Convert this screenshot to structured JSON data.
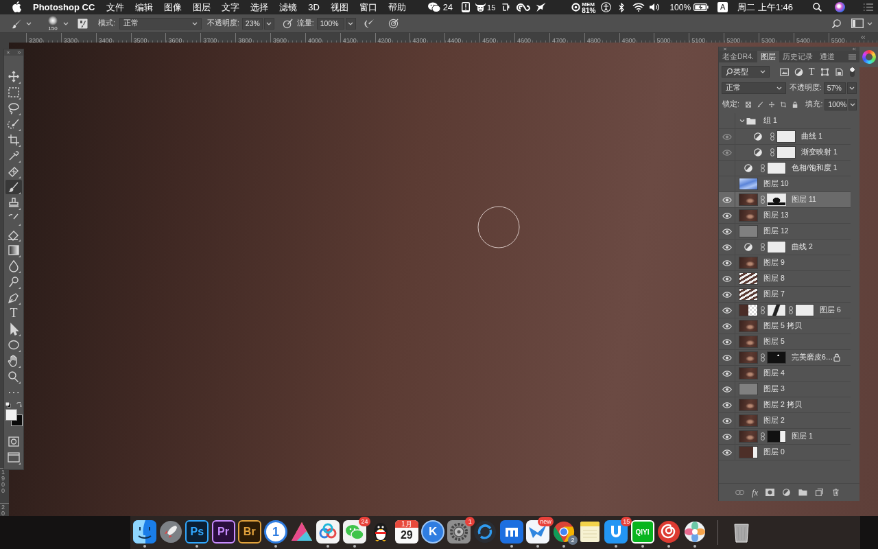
{
  "menubar": {
    "app": "Photoshop CC",
    "menus": [
      "文件",
      "编辑",
      "图像",
      "图层",
      "文字",
      "选择",
      "滤镜",
      "3D",
      "视图",
      "窗口",
      "帮助"
    ],
    "status": [
      {
        "kind": "wechat",
        "text": "24"
      },
      {
        "kind": "notebook"
      },
      {
        "kind": "bull",
        "text": "15"
      },
      {
        "kind": "hook"
      },
      {
        "kind": "loops"
      },
      {
        "kind": "bird"
      },
      {
        "kind": "mem",
        "label": "MEM",
        "text": "81%"
      },
      {
        "kind": "accessibility"
      },
      {
        "kind": "bluetooth"
      },
      {
        "kind": "wifi"
      },
      {
        "kind": "volume"
      },
      {
        "kind": "battery",
        "text": "100%"
      },
      {
        "kind": "input",
        "text": "A"
      },
      {
        "kind": "clock",
        "text": "周二 上午1:46"
      },
      {
        "kind": "search"
      },
      {
        "kind": "siri"
      },
      {
        "kind": "list"
      }
    ]
  },
  "options": {
    "brush_size": "150",
    "mode_label": "模式:",
    "mode": "正常",
    "opacity_label": "不透明度:",
    "opacity": "23%",
    "flow_label": "流量:",
    "flow": "100%"
  },
  "ruler": {
    "labels": [
      "3200",
      "3300",
      "3400",
      "3500",
      "3600",
      "3700",
      "3800",
      "3900",
      "4000",
      "4100",
      "4200",
      "4300",
      "4400",
      "4500",
      "4600",
      "4700",
      "4800",
      "4900",
      "5000",
      "5100",
      "5200",
      "5300",
      "5400",
      "5500"
    ],
    "vertical_labels": [
      "1900",
      "20"
    ]
  },
  "tools": [
    {
      "kind": "move",
      "selected": false
    },
    {
      "kind": "marquee",
      "selected": false
    },
    {
      "kind": "lasso",
      "selected": false
    },
    {
      "kind": "quickselect",
      "selected": false
    },
    {
      "kind": "crop",
      "selected": false
    },
    {
      "kind": "eyedropper",
      "selected": false
    },
    {
      "kind": "healing",
      "selected": false
    },
    {
      "kind": "brush",
      "selected": true
    },
    {
      "kind": "stamp",
      "selected": false
    },
    {
      "kind": "historybrush",
      "selected": false
    },
    {
      "kind": "eraser",
      "selected": false
    },
    {
      "kind": "gradient",
      "selected": false
    },
    {
      "kind": "blur",
      "selected": false
    },
    {
      "kind": "dodge",
      "selected": false
    },
    {
      "kind": "pen",
      "selected": false
    },
    {
      "kind": "type",
      "glyph": "T",
      "selected": false
    },
    {
      "kind": "pathselect",
      "selected": false
    },
    {
      "kind": "ellipse",
      "selected": false
    },
    {
      "kind": "hand",
      "selected": false
    },
    {
      "kind": "zoom",
      "selected": false
    },
    {
      "kind": "more",
      "selected": false
    }
  ],
  "layers_panel": {
    "tabs": [
      {
        "label": "老金DR4.",
        "selected": false
      },
      {
        "label": "图层",
        "selected": true
      },
      {
        "label": "历史记录",
        "selected": false
      },
      {
        "label": "通道",
        "selected": false
      }
    ],
    "filter": "类型",
    "type_filter": "T",
    "blend": "正常",
    "opacity_label": "不透明度:",
    "opacity": "57%",
    "lock_label": "锁定:",
    "fill_label": "填充:",
    "fill": "100%",
    "fx": "fx",
    "layers": [
      {
        "name": "组 1",
        "kind": "group",
        "visible": false,
        "expanded": true,
        "selected": false,
        "locked": false,
        "children": [
          {
            "name": "曲线 1",
            "kind": "adjustment",
            "visible": true,
            "selected": false,
            "locked": false,
            "masks": [
              {
                "kind": "white"
              }
            ]
          },
          {
            "name": "渐变映射 1",
            "kind": "adjustment",
            "visible": true,
            "selected": false,
            "locked": false,
            "masks": [
              {
                "kind": "white"
              }
            ]
          }
        ]
      },
      {
        "name": "色相/饱和度 1",
        "kind": "adjustment",
        "visible": false,
        "selected": false,
        "locked": false,
        "masks": [
          {
            "kind": "white"
          }
        ]
      },
      {
        "name": "图层 10",
        "kind": "pixel",
        "thumb": {
          "kind": "sky"
        },
        "visible": false,
        "selected": false,
        "locked": false
      },
      {
        "name": "图层 11",
        "kind": "pixel",
        "thumb": {
          "kind": "photo"
        },
        "visible": true,
        "selected": true,
        "locked": false,
        "masks": [
          {
            "kind": "shape"
          }
        ]
      },
      {
        "name": "图层 13",
        "kind": "pixel",
        "thumb": {
          "kind": "photo"
        },
        "visible": true,
        "selected": false,
        "locked": false
      },
      {
        "name": "图层 12",
        "kind": "pixel",
        "thumb": {
          "kind": "gray"
        },
        "visible": true,
        "selected": false,
        "locked": false
      },
      {
        "name": "曲线 2",
        "kind": "adjustment",
        "visible": true,
        "selected": false,
        "locked": false,
        "masks": [
          {
            "kind": "white"
          }
        ]
      },
      {
        "name": "图层 9",
        "kind": "pixel",
        "thumb": {
          "kind": "photo"
        },
        "visible": true,
        "selected": false,
        "locked": false
      },
      {
        "name": "图层 8",
        "kind": "pixel",
        "thumb": {
          "kind": "sketch"
        },
        "visible": true,
        "selected": false,
        "locked": false
      },
      {
        "name": "图层 7",
        "kind": "pixel",
        "thumb": {
          "kind": "sketch"
        },
        "visible": true,
        "selected": false,
        "locked": false
      },
      {
        "name": "图层 6",
        "kind": "pixel",
        "thumb": {
          "kind": "split"
        },
        "visible": true,
        "selected": false,
        "locked": false,
        "masks": [
          {
            "kind": "stroke"
          },
          {
            "kind": "white"
          }
        ]
      },
      {
        "name": "图层 5 拷贝",
        "kind": "pixel",
        "thumb": {
          "kind": "photo"
        },
        "visible": true,
        "selected": false,
        "locked": false
      },
      {
        "name": "图层 5",
        "kind": "pixel",
        "thumb": {
          "kind": "photo"
        },
        "visible": true,
        "selected": false,
        "locked": false
      },
      {
        "name": "完美磨皮6…",
        "kind": "pixel",
        "thumb": {
          "kind": "photo"
        },
        "visible": true,
        "selected": false,
        "locked": true,
        "masks": [
          {
            "kind": "black"
          }
        ]
      },
      {
        "name": "图层 4",
        "kind": "pixel",
        "thumb": {
          "kind": "photo"
        },
        "visible": true,
        "selected": false,
        "locked": false
      },
      {
        "name": "图层 3",
        "kind": "pixel",
        "thumb": {
          "kind": "gray"
        },
        "visible": true,
        "selected": false,
        "locked": false
      },
      {
        "name": "图层 2 拷贝",
        "kind": "pixel",
        "thumb": {
          "kind": "photo"
        },
        "visible": true,
        "selected": false,
        "locked": false
      },
      {
        "name": "图层 2",
        "kind": "pixel",
        "thumb": {
          "kind": "photo"
        },
        "visible": true,
        "selected": false,
        "locked": false
      },
      {
        "name": "图层 1",
        "kind": "pixel",
        "thumb": {
          "kind": "photo"
        },
        "visible": true,
        "selected": false,
        "locked": false,
        "masks": [
          {
            "kind": "edge"
          }
        ]
      },
      {
        "name": "图层 0",
        "kind": "pixel",
        "thumb": {
          "kind": "strip"
        },
        "visible": true,
        "selected": false,
        "locked": false
      }
    ]
  },
  "dock": [
    {
      "kind": "finder",
      "running": true
    },
    {
      "kind": "launchpad",
      "running": false
    },
    {
      "kind": "ps",
      "label": "Ps",
      "running": true
    },
    {
      "kind": "pr",
      "label": "Pr",
      "running": false
    },
    {
      "kind": "br",
      "label": "Br",
      "running": false
    },
    {
      "kind": "onepassword",
      "label": "1",
      "running": true
    },
    {
      "kind": "triangle",
      "running": false
    },
    {
      "kind": "rings",
      "running": true
    },
    {
      "kind": "wechat",
      "badge": "24",
      "running": true
    },
    {
      "kind": "penguin",
      "running": false
    },
    {
      "kind": "calendar",
      "month": "1月",
      "label": "29",
      "running": false
    },
    {
      "kind": "kcircle",
      "label": "K",
      "running": false
    },
    {
      "kind": "gear",
      "badge": "1",
      "running": false
    },
    {
      "kind": "swirl",
      "running": false
    },
    {
      "kind": "mtile",
      "running": true
    },
    {
      "kind": "bird",
      "badge": "new",
      "running": true
    },
    {
      "kind": "chrome",
      "badge": "2",
      "running": true
    },
    {
      "kind": "notes",
      "running": false
    },
    {
      "kind": "utile",
      "badge": "15",
      "running": true
    },
    {
      "kind": "iqiyi",
      "label": "QIYI",
      "running": true
    },
    {
      "kind": "music",
      "running": true
    },
    {
      "kind": "flower",
      "running": true
    },
    {
      "kind": "divider"
    },
    {
      "kind": "trash",
      "running": false
    }
  ]
}
